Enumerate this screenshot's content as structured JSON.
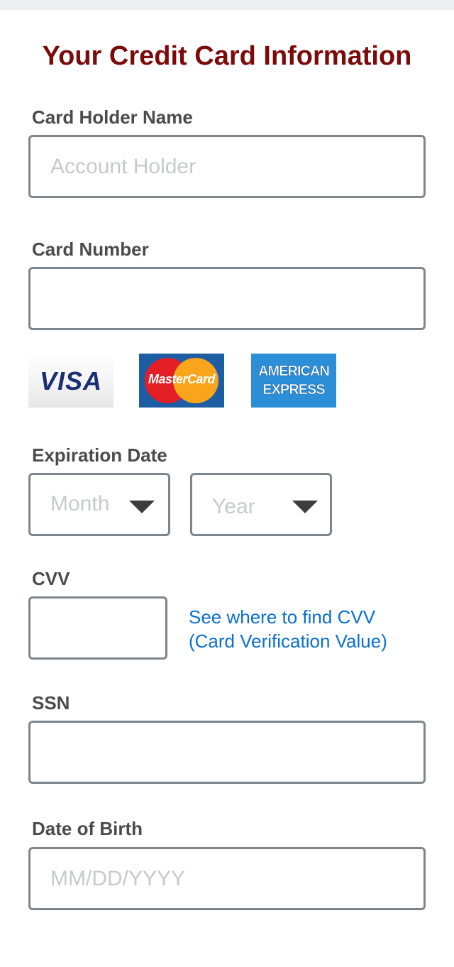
{
  "form": {
    "title": "Your Credit Card Information",
    "card_holder": {
      "label": "Card Holder Name",
      "placeholder": "Account Holder",
      "value": ""
    },
    "card_number": {
      "label": "Card Number",
      "placeholder": "",
      "value": ""
    },
    "card_logos": {
      "visa": "VISA",
      "mastercard": "MasterCard",
      "amex_line1": "AMERICAN",
      "amex_line2": "EXPRESS"
    },
    "expiration": {
      "label": "Expiration Date",
      "month_placeholder": "Month",
      "year_placeholder": "Year"
    },
    "cvv": {
      "label": "CVV",
      "value": "",
      "help_link_line1": "See where to find CVV",
      "help_link_line2": "(Card Verification Value)"
    },
    "ssn": {
      "label": "SSN",
      "value": ""
    },
    "dob": {
      "label": "Date of Birth",
      "placeholder": "MM/DD/YYYY",
      "value": ""
    }
  },
  "icons": {
    "dropdown": "chevron-down-icon"
  },
  "colors": {
    "title": "#7b0a0a",
    "label": "#4b4b4b",
    "field_border": "#7d868c",
    "placeholder": "#c7c9cc",
    "link": "#0b6fd0",
    "top_bar": "#eceef0"
  }
}
